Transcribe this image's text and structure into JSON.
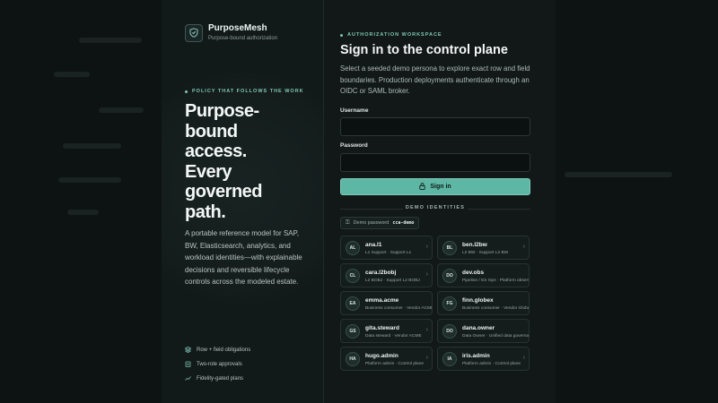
{
  "brand": {
    "name": "PurposeMesh",
    "tagline": "Purpose-bound authorization",
    "logo_icon": "shield-icon"
  },
  "hero": {
    "eyebrow": "POLICY THAT FOLLOWS THE WORK",
    "headline": "Purpose-bound access. Every governed path.",
    "description": "A portable reference model for SAP, BW, Elasticsearch, analytics, and workload identities—with explainable decisions and reversible lifecycle controls across the modeled estate.",
    "features": [
      {
        "icon": "layers-icon",
        "label": "Row + field obligations"
      },
      {
        "icon": "clipboard-icon",
        "label": "Two-role approvals"
      },
      {
        "icon": "trend-icon",
        "label": "Fidelity-gated plans"
      }
    ]
  },
  "login": {
    "eyebrow": "AUTHORIZATION WORKSPACE",
    "title": "Sign in to the control plane",
    "subtitle": "Select a seeded demo persona to explore exact row and field boundaries. Production deployments authenticate through an OIDC or SAML broker.",
    "username_label": "Username",
    "username_value": "",
    "password_label": "Password",
    "password_value": "",
    "signin_label": "Sign in",
    "demo_heading": "DEMO IDENTITIES",
    "demo_password_label": "Demo password",
    "demo_password_value": "cca-demo"
  },
  "personas": [
    {
      "initials": "AL",
      "name": "ana.l1",
      "role": "L1 Support · Support L1"
    },
    {
      "initials": "BL",
      "name": "ben.l2bw",
      "role": "L2 BW · Support L2 BW"
    },
    {
      "initials": "CL",
      "name": "cara.l2bobj",
      "role": "L2 BOBJ · Support L2 BOBJ"
    },
    {
      "initials": "DO",
      "name": "dev.obs",
      "role": "Pipeline / ES Ops · Platform observability"
    },
    {
      "initials": "EA",
      "name": "emma.acme",
      "role": "Business consumer · Vendor ACME"
    },
    {
      "initials": "FG",
      "name": "finn.globex",
      "role": "Business consumer · Vendor Globex"
    },
    {
      "initials": "GS",
      "name": "gita.steward",
      "role": "Data steward · Vendor ACME"
    },
    {
      "initials": "DO",
      "name": "dana.owner",
      "role": "Data Owner · Unified data governance"
    },
    {
      "initials": "HA",
      "name": "hugo.admin",
      "role": "Platform admin · Control plane"
    },
    {
      "initials": "IA",
      "name": "iris.admin",
      "role": "Platform admin · Control plane"
    }
  ],
  "colors": {
    "accent": "#5eb7a4",
    "background": "#0b1010",
    "card": "#111817"
  }
}
